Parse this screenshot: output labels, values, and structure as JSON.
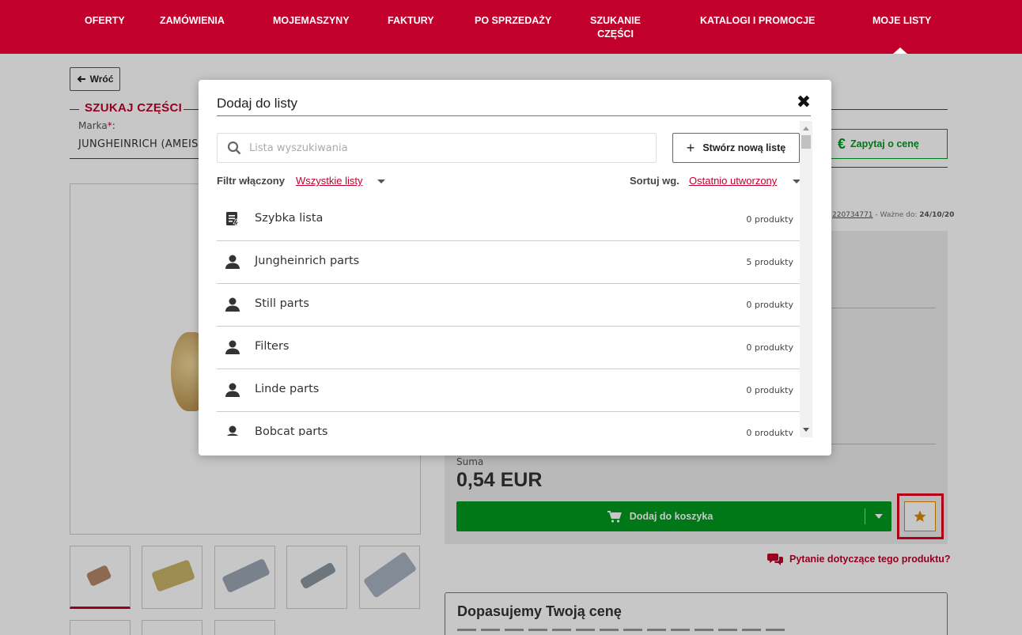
{
  "nav": {
    "items": [
      {
        "label": "OFERTY"
      },
      {
        "label": "ZAMÓWIENIA"
      },
      {
        "label": "MOJEMASZYNY"
      },
      {
        "label": "FAKTURY"
      },
      {
        "label": "PO SPRZEDAŻY"
      },
      {
        "label": "SZUKANIE\nCZĘŚCI"
      },
      {
        "label": "KATALOGI I PROMOCJE"
      },
      {
        "label": "MOJE LISTY"
      }
    ]
  },
  "page": {
    "back_label": "Wróć",
    "section_title": "SZUKAJ CZĘŚCI",
    "brand_label": "Marka",
    "brand_required": "*:",
    "brand_value": "JUNGHEINRICH (AMEIS",
    "ask_price_label": "Zapytaj o cenę",
    "ask_price_icon": "€",
    "meta_number": "220734771",
    "meta_valid_label": " - Ważne do: ",
    "meta_valid_date": "24/10/20",
    "sum_label": "Suma",
    "sum_value": "0,54 EUR",
    "cart_label": "Dodaj do koszyka",
    "question_label": "Pytanie dotyczące tego produktu?",
    "promo_title": "Dopasujemy Twoją cenę"
  },
  "modal": {
    "title": "Dodaj do listy",
    "close_glyph": "✖",
    "search_placeholder": "Lista wyszukiwania",
    "new_list_label": "Stwórz nową listę",
    "new_list_glyph": "+",
    "filter_label": "Filtr włączony",
    "filter_value": "Wszystkie listy",
    "sort_label": "Sortuj wg.",
    "sort_value": "Ostatnio utworzony",
    "lists": [
      {
        "name": "Szybka lista",
        "count": "0 produkty",
        "icon": "quick-list-icon"
      },
      {
        "name": "Jungheinrich parts",
        "count": "5 produkty",
        "icon": "user-icon"
      },
      {
        "name": "Still parts",
        "count": "0 produkty",
        "icon": "user-icon"
      },
      {
        "name": "Filters",
        "count": "0 produkty",
        "icon": "user-icon"
      },
      {
        "name": "Linde parts",
        "count": "0 produkty",
        "icon": "user-icon"
      },
      {
        "name": "Bobcat parts",
        "count": "0 produkty",
        "icon": "user-icon"
      }
    ]
  },
  "colors": {
    "brand_red": "#c1002b",
    "cart_green": "#009a1f",
    "favorite_orange": "#e28a00",
    "highlight_red": "#e3001b"
  }
}
